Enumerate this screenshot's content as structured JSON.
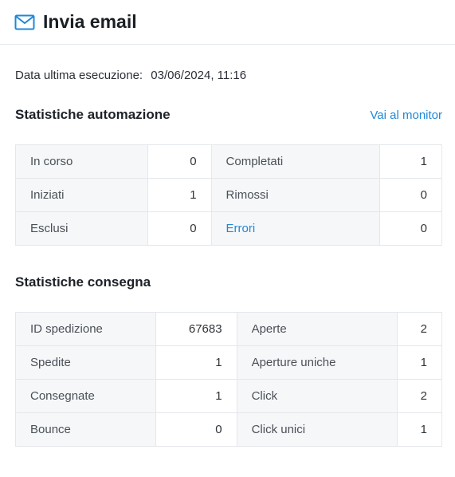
{
  "header": {
    "title": "Invia email",
    "icon": "envelope-icon",
    "accent": "#1e88d8"
  },
  "last_run": {
    "label": "Data ultima esecuzione:",
    "value": "03/06/2024, 11:16"
  },
  "automation": {
    "title": "Statistiche automazione",
    "monitor_link": "Vai al monitor",
    "rows": [
      {
        "l1": "In corso",
        "v1": "0",
        "l2": "Completati",
        "v2": "1"
      },
      {
        "l1": "Iniziati",
        "v1": "1",
        "l2": "Rimossi",
        "v2": "0"
      },
      {
        "l1": "Esclusi",
        "v1": "0",
        "l2": "Errori",
        "v2": "0"
      }
    ]
  },
  "delivery": {
    "title": "Statistiche consegna",
    "rows": [
      {
        "l1": "ID spedizione",
        "v1": "67683",
        "l2": "Aperte",
        "v2": "2"
      },
      {
        "l1": "Spedite",
        "v1": "1",
        "l2": "Aperture uniche",
        "v2": "1"
      },
      {
        "l1": "Consegnate",
        "v1": "1",
        "l2": "Click",
        "v2": "2"
      },
      {
        "l1": "Bounce",
        "v1": "0",
        "l2": "Click unici",
        "v2": "1"
      }
    ]
  }
}
